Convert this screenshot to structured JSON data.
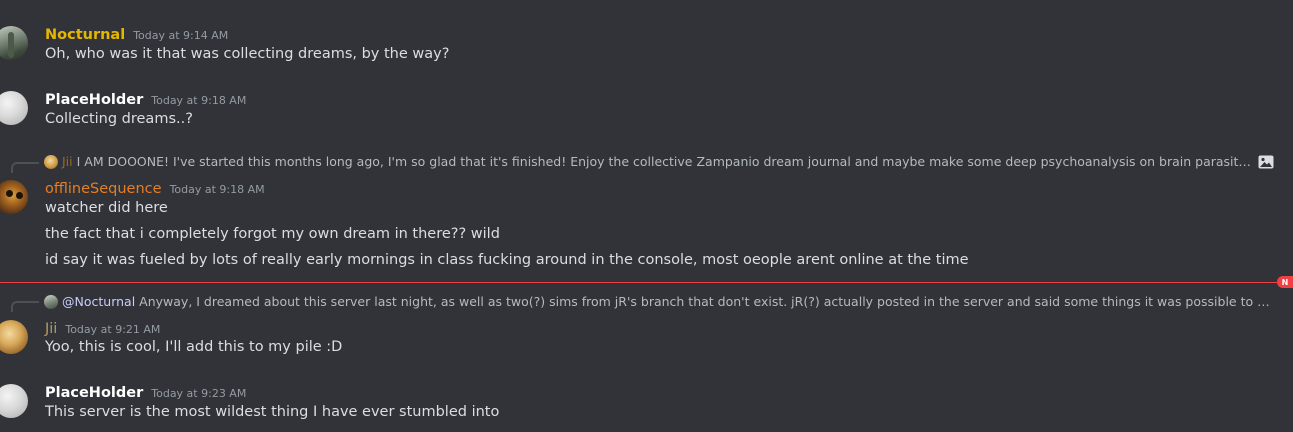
{
  "colors": {
    "background": "#313338",
    "nocturnal": "#e5b700",
    "placeholder": "#ffffff",
    "offlineSequence": "#e67e22",
    "jii": "#b59b5f",
    "new_divider": "#f23f43"
  },
  "messages": [
    {
      "author": "Nocturnal",
      "timestamp": "Today at 9:14 AM",
      "avatar_icon": "forest-road-avatar",
      "lines": [
        "Oh, who was it that was collecting dreams, by the way?"
      ]
    },
    {
      "author": "PlaceHolder",
      "timestamp": "Today at 9:18 AM",
      "avatar_icon": "gray-sphere-avatar",
      "lines": [
        "Collecting dreams..?"
      ]
    },
    {
      "author": "offlineSequence",
      "timestamp": "Today at 9:18 AM",
      "avatar_icon": "owl-avatar",
      "reply": {
        "author": "Jii",
        "text": "I AM DOOONE! I've started this months long ago, I'm so glad that it's finished! Enjoy the collective Zampanio dream journal and maybe make some deep psychoanalysis on brain parasites if you wish",
        "has_image_icon": true
      },
      "lines": [
        "watcher did here",
        "the fact that i completely forgot my own dream in there?? wild",
        "id say it was fueled by lots of really early mornings in class fucking around in the console, most oeople arent online at the time"
      ]
    },
    {
      "author": "Jii",
      "timestamp": "Today at 9:21 AM",
      "avatar_icon": "golden-portrait-avatar",
      "reply": {
        "author": "@Nocturnal",
        "text": "Anyway, I dreamed about this server last night, as well as two(?) sims from jR's branch that don't exist. jR(?) actually posted in the server and said some things it was possible to do in one of t..."
      },
      "lines": [
        "Yoo, this is cool, I'll add this to my pile :D"
      ]
    },
    {
      "author": "PlaceHolder",
      "timestamp": "Today at 9:23 AM",
      "avatar_icon": "gray-sphere-avatar",
      "lines": [
        "This server is the most wildest thing I have ever stumbled into"
      ]
    }
  ],
  "new_badge": "N"
}
